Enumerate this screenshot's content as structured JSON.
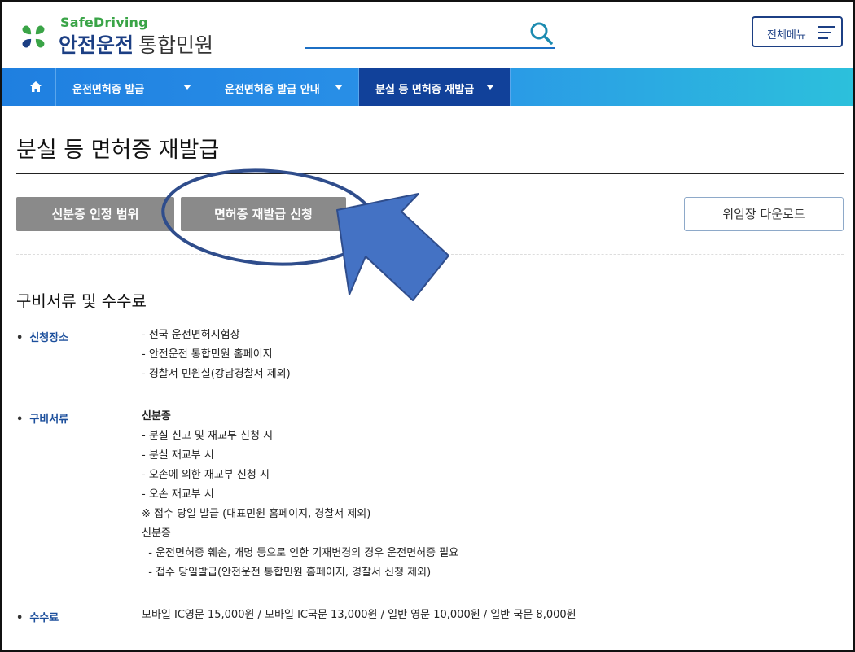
{
  "header": {
    "logo_sub": "SafeDriving",
    "logo_main": "안전운전",
    "logo_main_thin": "통합민원",
    "search_placeholder": "",
    "menu_label": "전체메뉴"
  },
  "nav": {
    "items": [
      {
        "label": "운전면허증 발급"
      },
      {
        "label": "운전면허증 발급 안내"
      },
      {
        "label": "분실 등 면허증 재발급"
      }
    ]
  },
  "page": {
    "title": "분실 등 면허증 재발급",
    "buttons": {
      "scope": "신분증 인정 범위",
      "reissue": "면허증 재발급 신청",
      "download": "위임장 다운로드"
    },
    "section_title": "구비서류 및 수수료",
    "rows": [
      {
        "label": "신청장소",
        "lines": [
          "- 전국 운전면허시험장",
          "- 안전운전 통합민원 홈페이지",
          "- 경찰서 민원실(강남경찰서 제외)"
        ]
      },
      {
        "label": "구비서류",
        "lines": [
          "신분증",
          "- 분실 신고 및 재교부 신청 시",
          "- 분실 재교부 시",
          "- 오손에 의한 재교부 신청 시",
          "- 오손 재교부 시",
          "※ 접수 당일 발급 (대표민원 홈페이지, 경찰서 제외)",
          "신분증",
          "  - 운전면허증 훼손, 개명 등으로 인한 기재변경의 경우 운전면허증 필요",
          "  - 접수 당일발급(안전운전 통합민원 홈페이지, 경찰서 신청 제외)"
        ]
      },
      {
        "label": "수수료",
        "lines": [
          "모바일 IC영문 15,000원 / 모바일 IC국문 13,000원 / 일반 영문 10,000원 / 일반 국문 8,000원"
        ]
      }
    ]
  },
  "colors": {
    "brand_navy": "#1c3f84",
    "brand_green": "#3aa447",
    "nav_active": "#11419a",
    "annotation_blue": "#4472c4",
    "annotation_outline": "#2f4d8c"
  }
}
